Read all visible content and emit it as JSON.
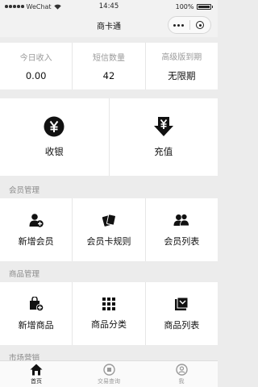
{
  "status_bar": {
    "carrier": "WeChat",
    "time": "14:45",
    "battery": "100%"
  },
  "nav": {
    "title": "商卡通"
  },
  "stats": [
    {
      "label": "今日收入",
      "value": "0.00"
    },
    {
      "label": "短信数量",
      "value": "42"
    },
    {
      "label": "高级版到期",
      "value": "无限期"
    }
  ],
  "main_actions": [
    {
      "label": "收银",
      "icon": "yen-circle-icon"
    },
    {
      "label": "充值",
      "icon": "yen-down-arrow-icon"
    }
  ],
  "member_section": {
    "title": "会员管理",
    "items": [
      {
        "label": "新增会员",
        "icon": "add-user-icon"
      },
      {
        "label": "会员卡规则",
        "icon": "cards-icon"
      },
      {
        "label": "会员列表",
        "icon": "users-icon"
      }
    ]
  },
  "goods_section": {
    "title": "商品管理",
    "items": [
      {
        "label": "新增商品",
        "icon": "add-bag-icon"
      },
      {
        "label": "商品分类",
        "icon": "grid-dots-icon"
      },
      {
        "label": "商品列表",
        "icon": "goods-list-icon"
      }
    ]
  },
  "market_section": {
    "title": "市场营销"
  },
  "tabbar": [
    {
      "label": "首页",
      "icon": "home-icon",
      "active": true
    },
    {
      "label": "交易查询",
      "icon": "transactions-icon",
      "active": false
    },
    {
      "label": "我",
      "icon": "profile-icon",
      "active": false
    }
  ]
}
